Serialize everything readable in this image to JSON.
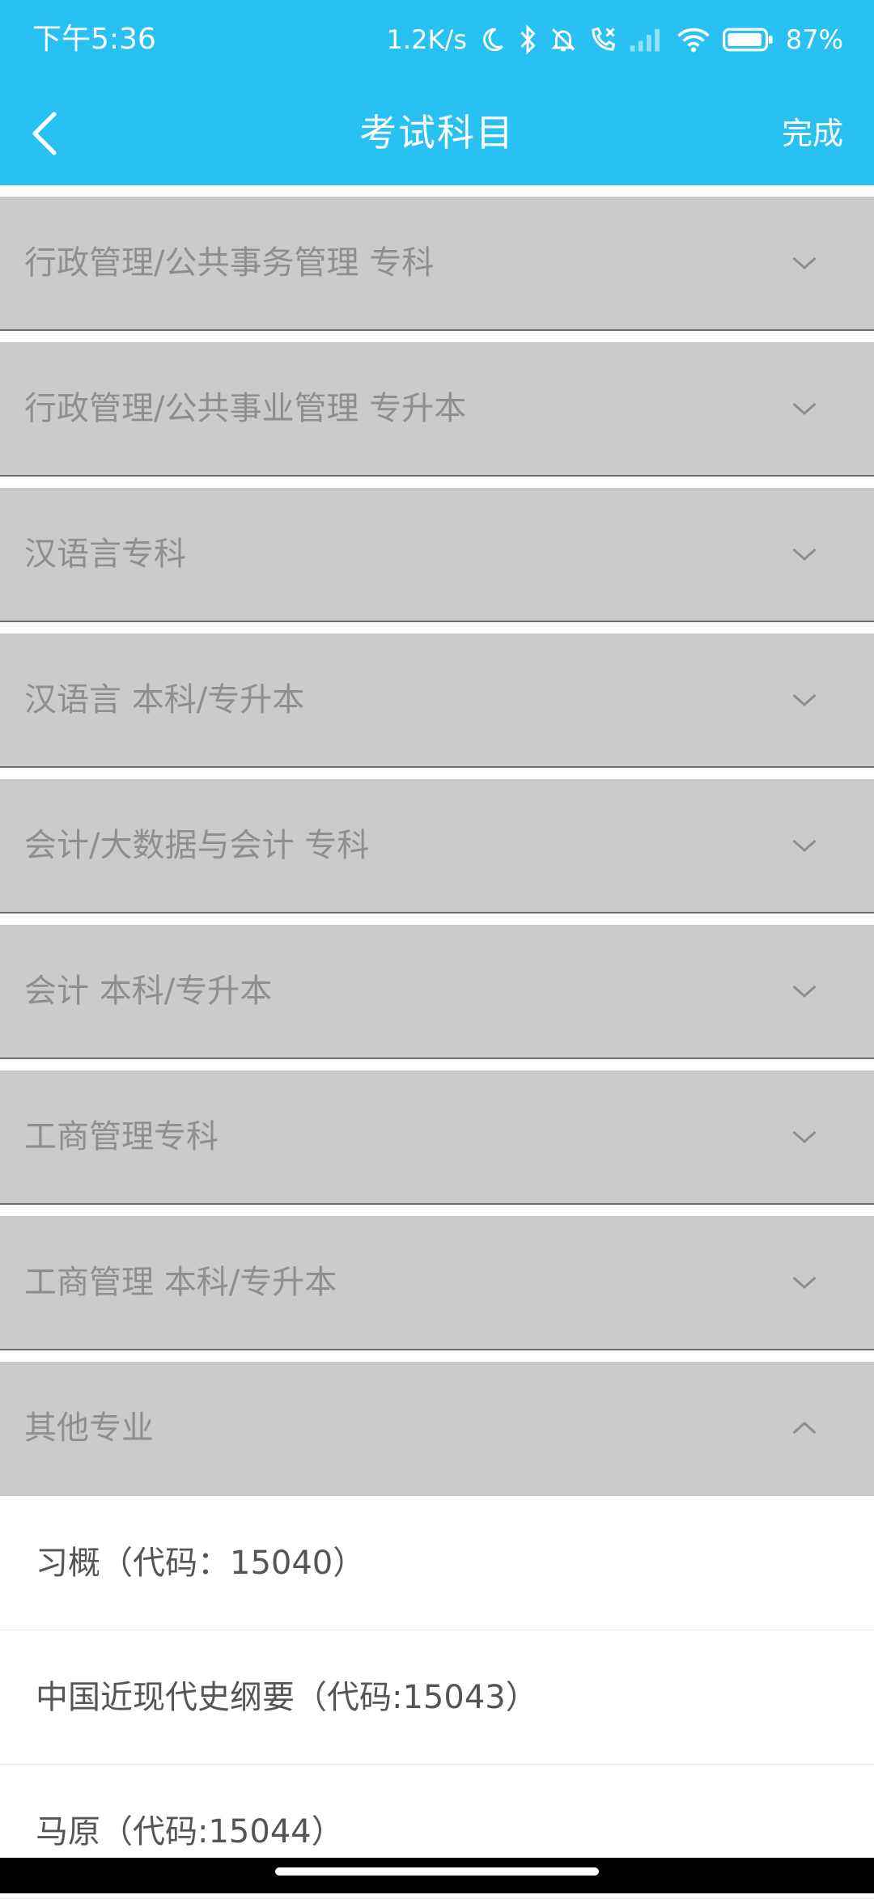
{
  "status": {
    "time": "下午5:36",
    "speed": "1.2K/s",
    "battery": "87%"
  },
  "nav": {
    "title": "考试科目",
    "done_label": "完成"
  },
  "groups": [
    {
      "label": "行政管理/公共事务管理 专科",
      "expanded": false
    },
    {
      "label": "行政管理/公共事业管理 专升本",
      "expanded": false
    },
    {
      "label": "汉语言专科",
      "expanded": false
    },
    {
      "label": "汉语言 本科/专升本",
      "expanded": false
    },
    {
      "label": "会计/大数据与会计 专科",
      "expanded": false
    },
    {
      "label": "会计 本科/专升本",
      "expanded": false
    },
    {
      "label": "工商管理专科",
      "expanded": false
    },
    {
      "label": "工商管理 本科/专升本",
      "expanded": false
    },
    {
      "label": "其他专业",
      "expanded": true
    }
  ],
  "sub_items": [
    {
      "label": "习概（代码：15040）"
    },
    {
      "label": "中国近现代史纲要（代码:15043）"
    },
    {
      "label": "马原（代码:15044）"
    }
  ],
  "colors": {
    "header_bg": "#29C0F2",
    "group_bg": "#CBCBCB",
    "group_text": "#8E8E8E"
  }
}
